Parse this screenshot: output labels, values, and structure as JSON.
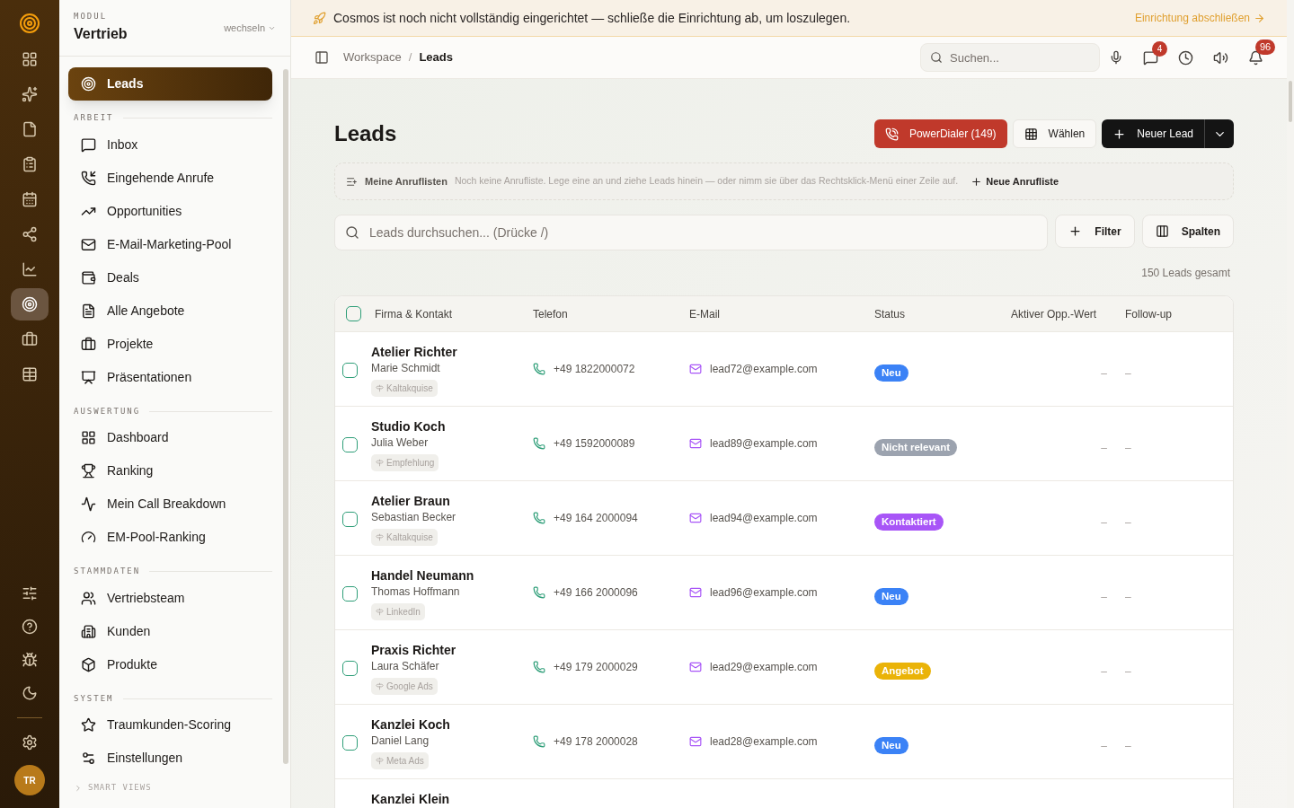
{
  "rail": {
    "items": [
      {
        "selected": false
      },
      {
        "selected": false
      },
      {
        "selected": false
      },
      {
        "selected": false
      },
      {
        "selected": false
      },
      {
        "selected": false
      },
      {
        "selected": false
      },
      {
        "selected": true
      },
      {
        "selected": false
      },
      {
        "selected": false
      }
    ],
    "avatar": "TR"
  },
  "sidebar": {
    "module_label": "MODUL",
    "module": "Vertrieb",
    "switch": "wechseln",
    "switch_expanded": false,
    "active": {
      "label": "Leads",
      "selected": true
    },
    "sections": [
      {
        "title": "ARBEIT",
        "items": [
          {
            "label": "Inbox",
            "selected": false
          },
          {
            "label": "Eingehende Anrufe",
            "selected": false
          },
          {
            "label": "Opportunities",
            "selected": false
          },
          {
            "label": "E-Mail-Marketing-Pool",
            "selected": false
          },
          {
            "label": "Deals",
            "selected": false
          },
          {
            "label": "Alle Angebote",
            "selected": false
          },
          {
            "label": "Projekte",
            "selected": false
          },
          {
            "label": "Präsentationen",
            "selected": false
          }
        ]
      },
      {
        "title": "AUSWERTUNG",
        "items": [
          {
            "label": "Dashboard",
            "selected": false
          },
          {
            "label": "Ranking",
            "selected": false
          },
          {
            "label": "Mein Call Breakdown",
            "selected": false
          },
          {
            "label": "EM-Pool-Ranking",
            "selected": false
          }
        ]
      },
      {
        "title": "STAMMDATEN",
        "items": [
          {
            "label": "Vertriebsteam",
            "selected": false
          },
          {
            "label": "Kunden",
            "selected": false
          },
          {
            "label": "Produkte",
            "selected": false
          }
        ]
      },
      {
        "title": "SYSTEM",
        "items": [
          {
            "label": "Traumkunden-Scoring",
            "selected": false
          },
          {
            "label": "Einstellungen",
            "selected": false
          }
        ]
      }
    ],
    "smart_views": {
      "label": "SMART VIEWS",
      "expanded": false
    }
  },
  "banner": {
    "text": "Cosmos ist noch nicht vollständig eingerichtet — schließe die Einrichtung ab, um loszulegen.",
    "action": "Einrichtung abschließen"
  },
  "topbar": {
    "breadcrumb": [
      "Workspace",
      "Leads"
    ],
    "separator": "/",
    "search": {
      "placeholder": "Suchen..."
    },
    "messages_badge": "4",
    "notifications_badge": "96"
  },
  "page": {
    "title": "Leads",
    "buttons": {
      "powerdialer": "PowerDialer (149)",
      "select": "Wählen",
      "new_lead": "Neuer Lead"
    },
    "call_lists": {
      "title": "Meine Anruflisten",
      "hint": "Noch keine Anrufliste. Lege eine an und ziehe Leads hinein — oder nimm sie über das Rechtsklick-Menü einer Zeile auf.",
      "action": "Neue Anrufliste"
    },
    "search": {
      "placeholder": "Leads durchsuchen... (Drücke /)"
    },
    "filter": "Filter",
    "columns_button": "Spalten",
    "total": "150 Leads gesamt"
  },
  "table": {
    "header_checked": false,
    "columns": [
      "Firma & Kontakt",
      "Telefon",
      "E-Mail",
      "Status",
      "Aktiver Opp.-Wert",
      "Follow-up"
    ],
    "rows": [
      {
        "company": "Atelier Richter",
        "contact": "Marie Schmidt",
        "source": "Kaltakquise",
        "phone": "+49 1822000072",
        "email": "lead72@example.com",
        "status": "Neu",
        "color": "#3b82f6",
        "value": "–",
        "followup": "–",
        "checked": false
      },
      {
        "company": "Studio Koch",
        "contact": "Julia Weber",
        "source": "Empfehlung",
        "phone": "+49 1592000089",
        "email": "lead89@example.com",
        "status": "Nicht relevant",
        "color": "#9ca3af",
        "value": "–",
        "followup": "–",
        "checked": false
      },
      {
        "company": "Atelier Braun",
        "contact": "Sebastian Becker",
        "source": "Kaltakquise",
        "phone": "+49 164 2000094",
        "email": "lead94@example.com",
        "status": "Kontaktiert",
        "color": "#a855f7",
        "value": "–",
        "followup": "–",
        "checked": false
      },
      {
        "company": "Handel Neumann",
        "contact": "Thomas Hoffmann",
        "source": "LinkedIn",
        "phone": "+49 166 2000096",
        "email": "lead96@example.com",
        "status": "Neu",
        "color": "#3b82f6",
        "value": "–",
        "followup": "–",
        "checked": false
      },
      {
        "company": "Praxis Richter",
        "contact": "Laura Schäfer",
        "source": "Google Ads",
        "phone": "+49 179 2000029",
        "email": "lead29@example.com",
        "status": "Angebot",
        "color": "#eab308",
        "value": "–",
        "followup": "–",
        "checked": false
      },
      {
        "company": "Kanzlei Koch",
        "contact": "Daniel Lang",
        "source": "Meta Ads",
        "phone": "+49 178 2000028",
        "email": "lead28@example.com",
        "status": "Neu",
        "color": "#3b82f6",
        "value": "–",
        "followup": "–",
        "checked": false
      },
      {
        "company": "Kanzlei Klein"
      }
    ]
  }
}
